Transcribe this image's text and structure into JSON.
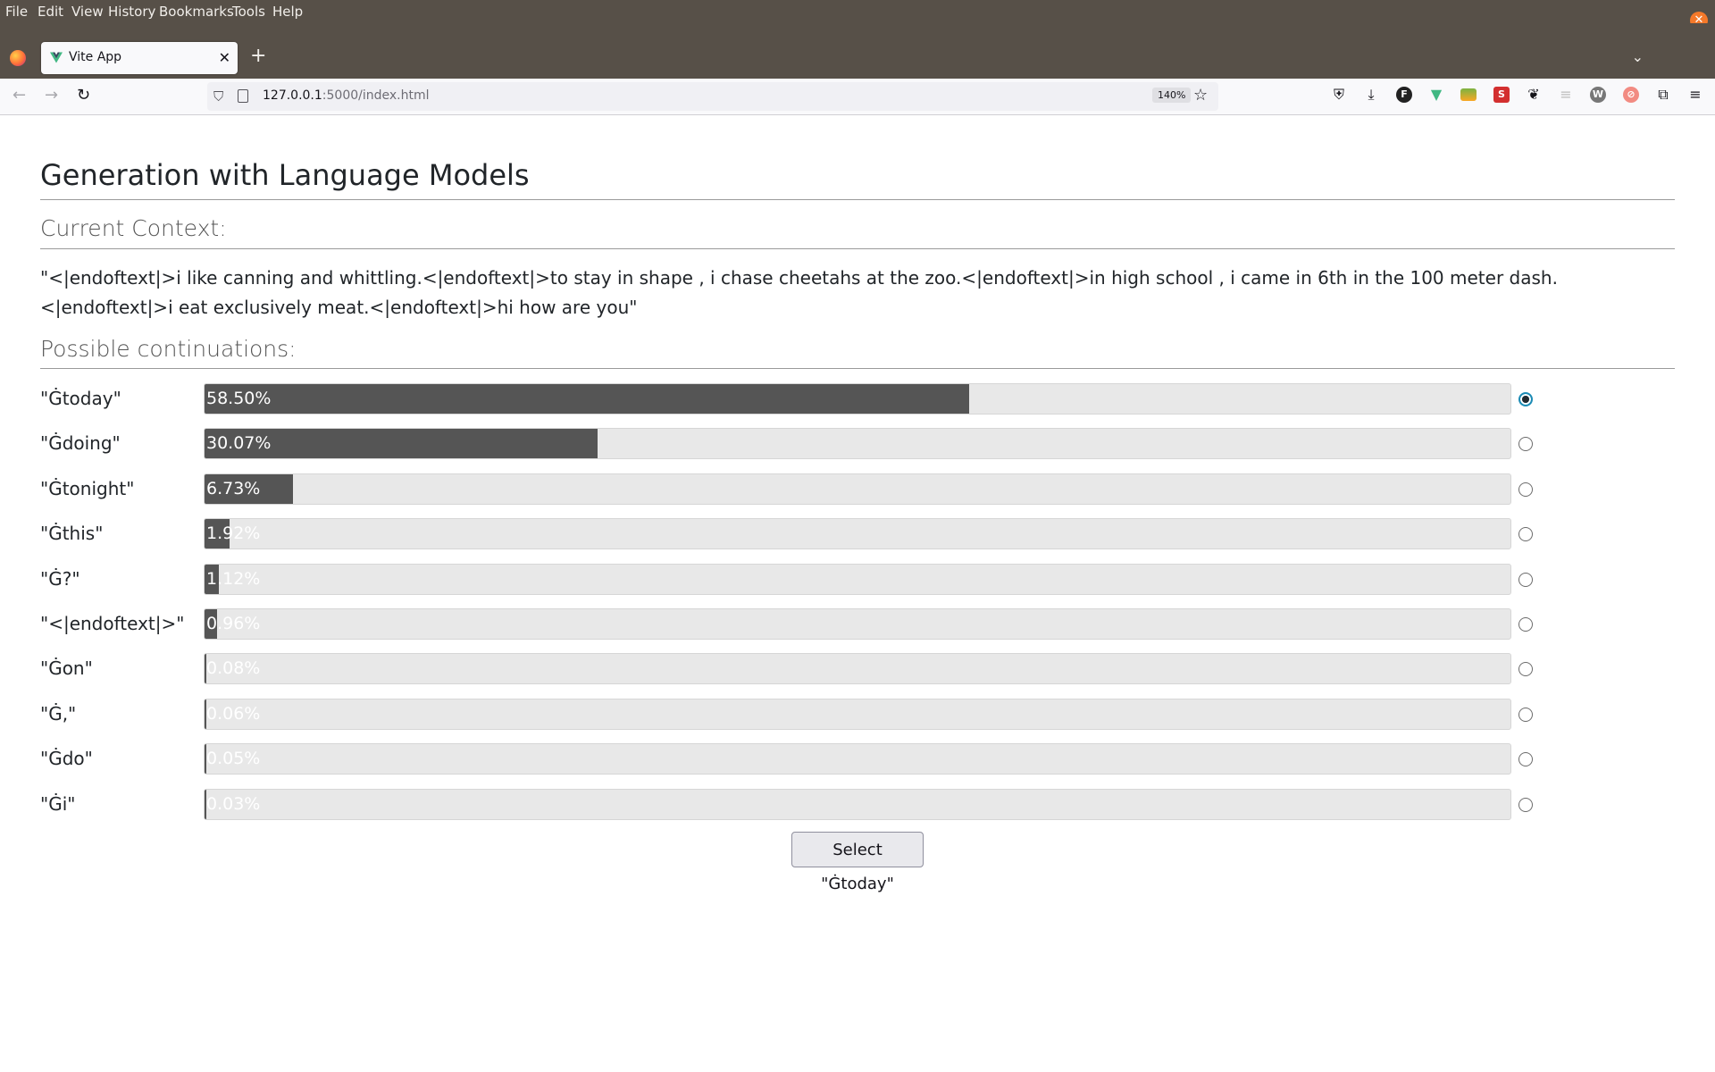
{
  "browser": {
    "menu": [
      "File",
      "Edit",
      "View",
      "History",
      "Bookmarks",
      "Tools",
      "Help"
    ],
    "tab_title": "Vite App",
    "url_host": "127.0.0.1",
    "url_rest": ":5000/index.html",
    "zoom": "140%",
    "new_tab_symbol": "+"
  },
  "page": {
    "title": "Generation with Language Models",
    "context_heading": "Current Context:",
    "context_text": "\"<|endoftext|>i like canning and whittling.<|endoftext|>to stay in shape , i chase cheetahs at the zoo.<|endoftext|>in high school , i came in 6th in the 100 meter dash.<|endoftext|>i eat exclusively meat.<|endoftext|>hi how are you\"",
    "continuations_heading": "Possible continuations:",
    "continuations": [
      {
        "token": "\"Ġtoday\"",
        "percent_label": "58.50%",
        "value": 58.5,
        "selected": true
      },
      {
        "token": "\"Ġdoing\"",
        "percent_label": "30.07%",
        "value": 30.07,
        "selected": false
      },
      {
        "token": "\"Ġtonight\"",
        "percent_label": "6.73%",
        "value": 6.73,
        "selected": false
      },
      {
        "token": "\"Ġthis\"",
        "percent_label": "1.92%",
        "value": 1.92,
        "selected": false
      },
      {
        "token": "\"Ġ?\"",
        "percent_label": "1.12%",
        "value": 1.12,
        "selected": false
      },
      {
        "token": "\"<|endoftext|>\"",
        "percent_label": "0.96%",
        "value": 0.96,
        "selected": false
      },
      {
        "token": "\"Ġon\"",
        "percent_label": "0.08%",
        "value": 0.08,
        "selected": false
      },
      {
        "token": "\"Ġ,\"",
        "percent_label": "0.06%",
        "value": 0.06,
        "selected": false
      },
      {
        "token": "\"Ġdo\"",
        "percent_label": "0.05%",
        "value": 0.05,
        "selected": false
      },
      {
        "token": "\"Ġi\"",
        "percent_label": "0.03%",
        "value": 0.03,
        "selected": false
      }
    ],
    "select_button_label": "Select \"Ġtoday\""
  },
  "colors": {
    "bar_fill": "#555555",
    "bar_track": "#e8e8e8",
    "radio_selected": "#1c8bb5"
  }
}
